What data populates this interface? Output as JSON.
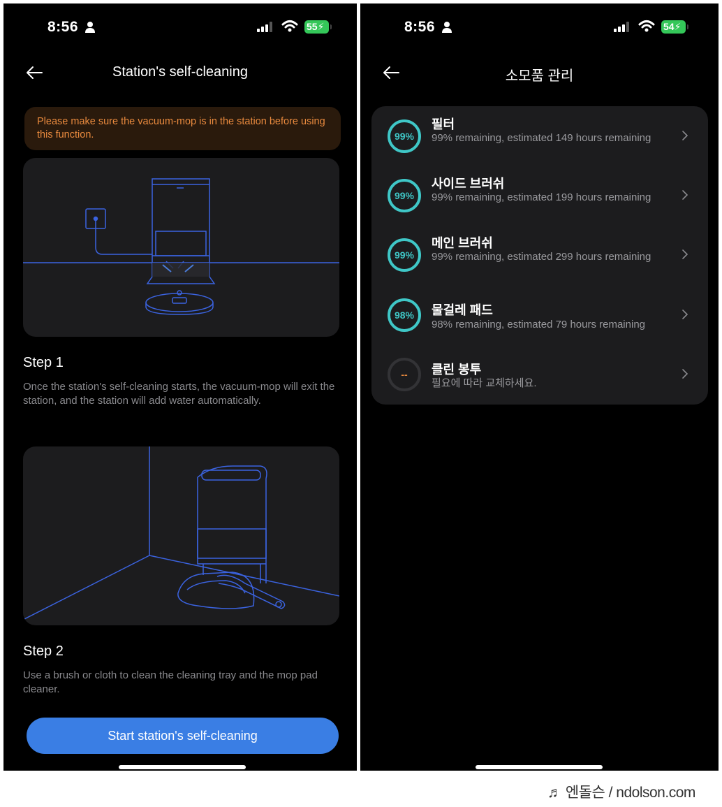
{
  "left_screen": {
    "status": {
      "time": "8:56",
      "battery": "55"
    },
    "title": "Station's self-cleaning",
    "warning": "Please make sure the vacuum-mop is in the station before using this function.",
    "step1": {
      "title": "Step 1",
      "description": "Once the station's self-cleaning starts, the vacuum-mop will exit the station, and the station will add water automatically."
    },
    "step2": {
      "title": "Step 2",
      "description": " Use a brush or cloth to clean the cleaning tray and the mop pad cleaner."
    },
    "start_button": "Start station's self-cleaning"
  },
  "right_screen": {
    "status": {
      "time": "8:56",
      "battery": "54"
    },
    "title": "소모품 관리",
    "items": [
      {
        "name": "필터",
        "percent_label": "99%",
        "percent": 99,
        "description": "99% remaining, estimated 149 hours remaining"
      },
      {
        "name": "사이드 브러쉬",
        "percent_label": "99%",
        "percent": 99,
        "description": "99% remaining, estimated 199 hours remaining"
      },
      {
        "name": "메인 브러쉬",
        "percent_label": "99%",
        "percent": 99,
        "description": "99% remaining, estimated 299 hours remaining"
      },
      {
        "name": "물걸레 패드",
        "percent_label": "98%",
        "percent": 98,
        "description": "98% remaining, estimated 79 hours remaining"
      },
      {
        "name": "클린 봉투",
        "percent_label": "--",
        "percent": null,
        "description": "필요에 따라 교체하세요."
      }
    ]
  },
  "watermark": "♬ 엔돌슨 / ndolson.com",
  "colors": {
    "accent_teal": "#3fc7c7",
    "warning_orange": "#e98a3e",
    "button_blue": "#3a7ee4",
    "battery_green": "#34c759",
    "line_blue": "#3b63e0"
  }
}
